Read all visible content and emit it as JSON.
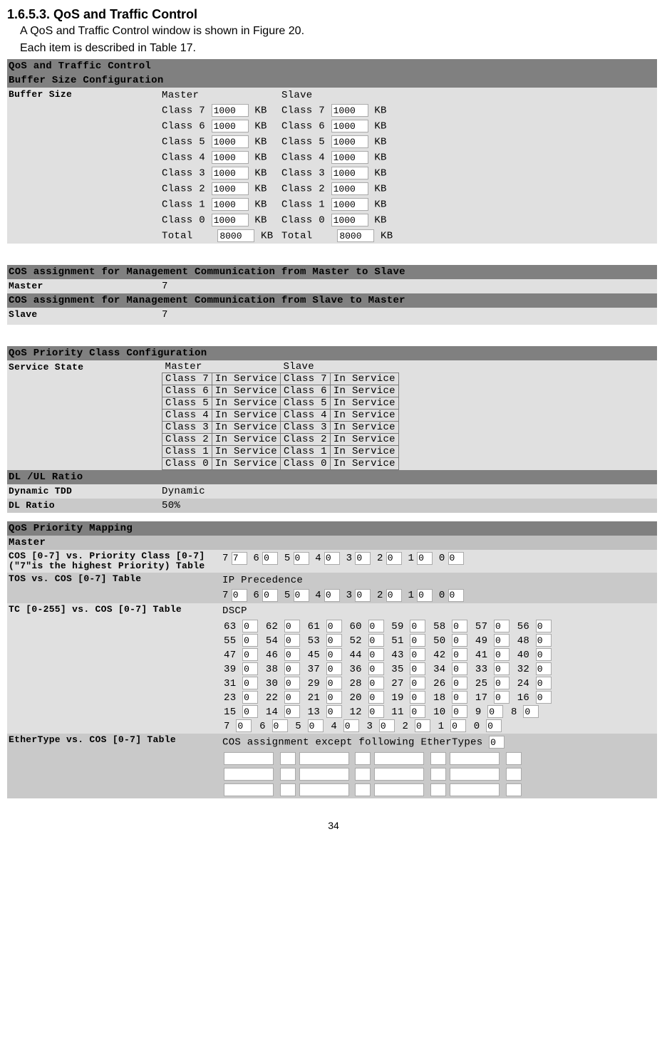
{
  "heading": "1.6.5.3. QoS and Traffic Control",
  "intro1": "A QoS and Traffic Control window is shown in Figure 20.",
  "intro2": "Each item is described in Table 17.",
  "mainTitle": "QoS and Traffic Control",
  "bufferSection": "Buffer Size Configuration",
  "bufferLabel": "Buffer Size",
  "masterLabel": "Master",
  "slaveLabel": "Slave",
  "kb": "KB",
  "buffer": {
    "classes": [
      "Class 7",
      "Class 6",
      "Class 5",
      "Class 4",
      "Class 3",
      "Class 2",
      "Class 1",
      "Class 0"
    ],
    "masterValues": [
      "1000",
      "1000",
      "1000",
      "1000",
      "1000",
      "1000",
      "1000",
      "1000"
    ],
    "slaveValues": [
      "1000",
      "1000",
      "1000",
      "1000",
      "1000",
      "1000",
      "1000",
      "1000"
    ],
    "totalLabel": "Total",
    "masterTotal": "8000",
    "slaveTotal": "8000"
  },
  "cosHeader1": "COS assignment for Management Communication from Master to Slave",
  "cosRow1Label": "Master",
  "cosRow1Value": "7",
  "cosHeader2": "COS assignment for Management Communication from Slave to Master",
  "cosRow2Label": "Slave",
  "cosRow2Value": "7",
  "qosPrioHeader": "QoS Priority Class Configuration",
  "serviceStateLabel": "Service State",
  "serviceState": {
    "headers": [
      "Master",
      "Slave"
    ],
    "rows": [
      [
        "Class 7",
        "In Service",
        "Class 7",
        "In Service"
      ],
      [
        "Class 6",
        "In Service",
        "Class 6",
        "In Service"
      ],
      [
        "Class 5",
        "In Service",
        "Class 5",
        "In Service"
      ],
      [
        "Class 4",
        "In Service",
        "Class 4",
        "In Service"
      ],
      [
        "Class 3",
        "In Service",
        "Class 3",
        "In Service"
      ],
      [
        "Class 2",
        "In Service",
        "Class 2",
        "In Service"
      ],
      [
        "Class 1",
        "In Service",
        "Class 1",
        "In Service"
      ],
      [
        "Class 0",
        "In Service",
        "Class 0",
        "In Service"
      ]
    ]
  },
  "dlulHeader": "DL /UL Ratio",
  "dynTddLabel": "Dynamic TDD",
  "dynTddValue": "Dynamic",
  "dlRatioLabel": "DL Ratio",
  "dlRatioValue": "50%",
  "qosMapHeader": "QoS Priority Mapping",
  "masterRowLabel": "Master",
  "cosVsPrioLabel": "COS [0-7] vs. Priority Class [0-7](\"7\"is the highest Priority) Table",
  "cosVsPrio": [
    "7",
    "7",
    "6",
    "0",
    "5",
    "0",
    "4",
    "0",
    "3",
    "0",
    "2",
    "0",
    "1",
    "0",
    "0",
    "0"
  ],
  "tosVsCosLabel": "TOS vs. COS [0-7] Table",
  "ipPrecedence": "IP Precedence",
  "tosVsCos": [
    "7",
    "0",
    "6",
    "0",
    "5",
    "0",
    "4",
    "0",
    "3",
    "0",
    "2",
    "0",
    "1",
    "0",
    "0",
    "0"
  ],
  "tcVsCosLabel": "TC [0-255] vs. COS [0-7] Table",
  "dscpLabel": "DSCP",
  "dscp": [
    [
      [
        "63",
        "0"
      ],
      [
        "62",
        "0"
      ],
      [
        "61",
        "0"
      ],
      [
        "60",
        "0"
      ],
      [
        "59",
        "0"
      ],
      [
        "58",
        "0"
      ],
      [
        "57",
        "0"
      ],
      [
        "56",
        "0"
      ]
    ],
    [
      [
        "55",
        "0"
      ],
      [
        "54",
        "0"
      ],
      [
        "53",
        "0"
      ],
      [
        "52",
        "0"
      ],
      [
        "51",
        "0"
      ],
      [
        "50",
        "0"
      ],
      [
        "49",
        "0"
      ],
      [
        "48",
        "0"
      ]
    ],
    [
      [
        "47",
        "0"
      ],
      [
        "46",
        "0"
      ],
      [
        "45",
        "0"
      ],
      [
        "44",
        "0"
      ],
      [
        "43",
        "0"
      ],
      [
        "42",
        "0"
      ],
      [
        "41",
        "0"
      ],
      [
        "40",
        "0"
      ]
    ],
    [
      [
        "39",
        "0"
      ],
      [
        "38",
        "0"
      ],
      [
        "37",
        "0"
      ],
      [
        "36",
        "0"
      ],
      [
        "35",
        "0"
      ],
      [
        "34",
        "0"
      ],
      [
        "33",
        "0"
      ],
      [
        "32",
        "0"
      ]
    ],
    [
      [
        "31",
        "0"
      ],
      [
        "30",
        "0"
      ],
      [
        "29",
        "0"
      ],
      [
        "28",
        "0"
      ],
      [
        "27",
        "0"
      ],
      [
        "26",
        "0"
      ],
      [
        "25",
        "0"
      ],
      [
        "24",
        "0"
      ]
    ],
    [
      [
        "23",
        "0"
      ],
      [
        "22",
        "0"
      ],
      [
        "21",
        "0"
      ],
      [
        "20",
        "0"
      ],
      [
        "19",
        "0"
      ],
      [
        "18",
        "0"
      ],
      [
        "17",
        "0"
      ],
      [
        "16",
        "0"
      ]
    ],
    [
      [
        "15",
        "0"
      ],
      [
        "14",
        "0"
      ],
      [
        "13",
        "0"
      ],
      [
        "12",
        "0"
      ],
      [
        "11",
        "0"
      ],
      [
        "10",
        "0"
      ],
      [
        "9",
        "0"
      ],
      [
        "8",
        "0"
      ]
    ],
    [
      [
        "7",
        "0"
      ],
      [
        "6",
        "0"
      ],
      [
        "5",
        "0"
      ],
      [
        "4",
        "0"
      ],
      [
        "3",
        "0"
      ],
      [
        "2",
        "0"
      ],
      [
        "1",
        "0"
      ],
      [
        "0",
        "0"
      ]
    ]
  ],
  "etherTypeLabel": "EtherType vs. COS [0-7] Table",
  "etherTypeText": "COS assignment except following EtherTypes",
  "etherTypeValue": "0",
  "pageNumber": "34"
}
